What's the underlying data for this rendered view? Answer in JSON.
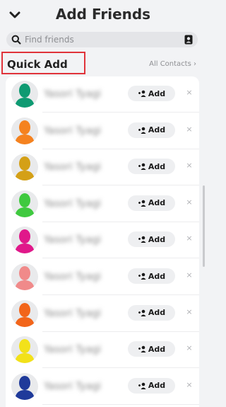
{
  "header": {
    "title": "Add Friends"
  },
  "search": {
    "placeholder": "Find friends",
    "value": ""
  },
  "quick_add": {
    "title": "Quick Add",
    "all_contacts": "All Contacts ›"
  },
  "add_label": "Add",
  "dismiss_label": "×",
  "friends": [
    {
      "name": "Yasori Tyagi",
      "color": "#0e9a72"
    },
    {
      "name": "Yasori Tyagi",
      "color": "#f5821f"
    },
    {
      "name": "Yasori Tyagi",
      "color": "#d4a017"
    },
    {
      "name": "Yasori Tyagi",
      "color": "#3fc93f"
    },
    {
      "name": "Yasori Tyagi",
      "color": "#e0188a"
    },
    {
      "name": "Yasori Tyagi",
      "color": "#f08a8a"
    },
    {
      "name": "Yasori Tyagi",
      "color": "#f2651a"
    },
    {
      "name": "Yasori Tyagi",
      "color": "#f2e11a"
    },
    {
      "name": "Yasori Tyagi",
      "color": "#1f3a9a"
    }
  ]
}
